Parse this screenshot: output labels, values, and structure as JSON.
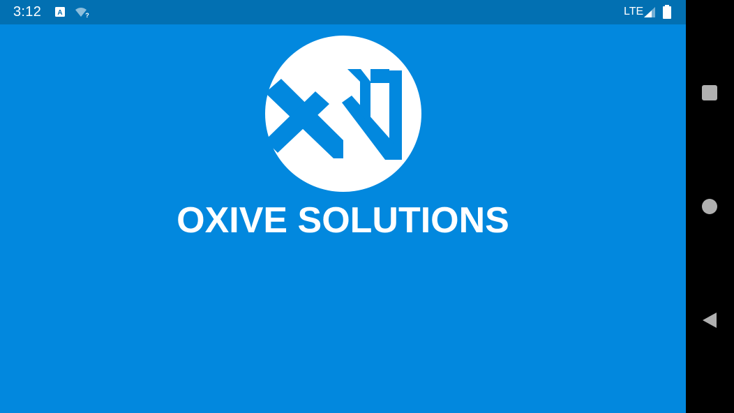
{
  "status_bar": {
    "time": "3:12",
    "network_label": "LTE",
    "icons": [
      "a-notification-icon",
      "wifi-unknown-icon",
      "cell-signal-icon",
      "battery-icon"
    ]
  },
  "splash": {
    "brand_name": "OXIVE SOLUTIONS",
    "logo_icon": "xn-logo-icon",
    "background_color": "#0288de",
    "status_bar_color": "#0270b2"
  },
  "nav_bar": {
    "buttons": [
      "recents-button",
      "home-button",
      "back-button"
    ]
  }
}
